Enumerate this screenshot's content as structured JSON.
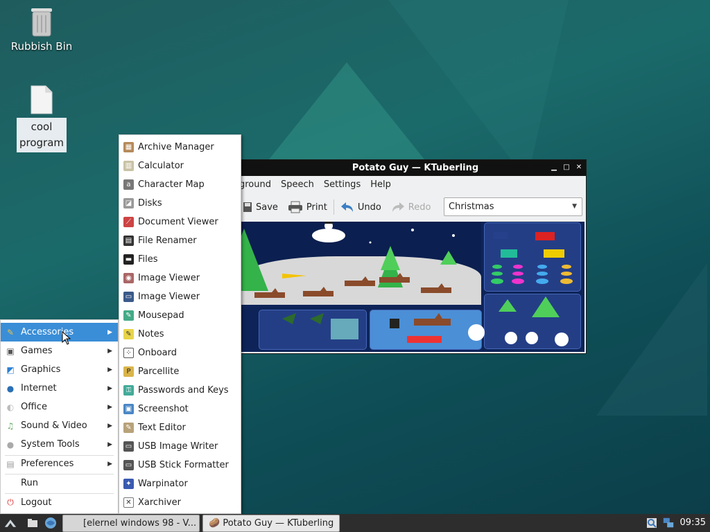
{
  "desktop": {
    "icons": [
      {
        "label": "Rubbish Bin",
        "icon": "trash-icon"
      },
      {
        "label": "cool program",
        "icon": "file-icon"
      }
    ]
  },
  "window": {
    "title": "Potato Guy — KTuberling",
    "menubar": [
      "ground",
      "Speech",
      "Settings",
      "Help"
    ],
    "toolbar": {
      "save": "Save",
      "print": "Print",
      "undo": "Undo",
      "redo": "Redo"
    },
    "theme_selected": "Christmas"
  },
  "main_menu": {
    "items": [
      {
        "label": "Accessories",
        "icon": "accessories-icon",
        "submenu": true,
        "active": true
      },
      {
        "label": "Games",
        "icon": "games-icon",
        "submenu": true
      },
      {
        "label": "Graphics",
        "icon": "graphics-icon",
        "submenu": true
      },
      {
        "label": "Internet",
        "icon": "internet-icon",
        "submenu": true
      },
      {
        "label": "Office",
        "icon": "office-icon",
        "submenu": true
      },
      {
        "label": "Sound & Video",
        "icon": "sound-video-icon",
        "submenu": true
      },
      {
        "label": "System Tools",
        "icon": "system-tools-icon",
        "submenu": true
      },
      {
        "label": "Preferences",
        "icon": "preferences-icon",
        "submenu": true
      },
      {
        "label": "Run",
        "icon": "",
        "submenu": false
      },
      {
        "label": "Logout",
        "icon": "logout-icon",
        "submenu": false
      }
    ]
  },
  "submenu": {
    "items": [
      "Archive Manager",
      "Calculator",
      "Character Map",
      "Disks",
      "Document Viewer",
      "File Renamer",
      "Files",
      "Image Viewer",
      "Image Viewer",
      "Mousepad",
      "Notes",
      "Onboard",
      "Parcellite",
      "Passwords and Keys",
      "Screenshot",
      "Text Editor",
      "USB Image Writer",
      "USB Stick Formatter",
      "Warpinator",
      "Xarchiver"
    ]
  },
  "taskbar": {
    "tasks": [
      "[elernel windows 98 - V...",
      "Potato Guy — KTuberling"
    ],
    "clock": "09:35"
  },
  "colors": {
    "menu_highlight": "#3a8ed7",
    "taskbar": "#2d2d2d",
    "window_titlebar": "#111111"
  }
}
